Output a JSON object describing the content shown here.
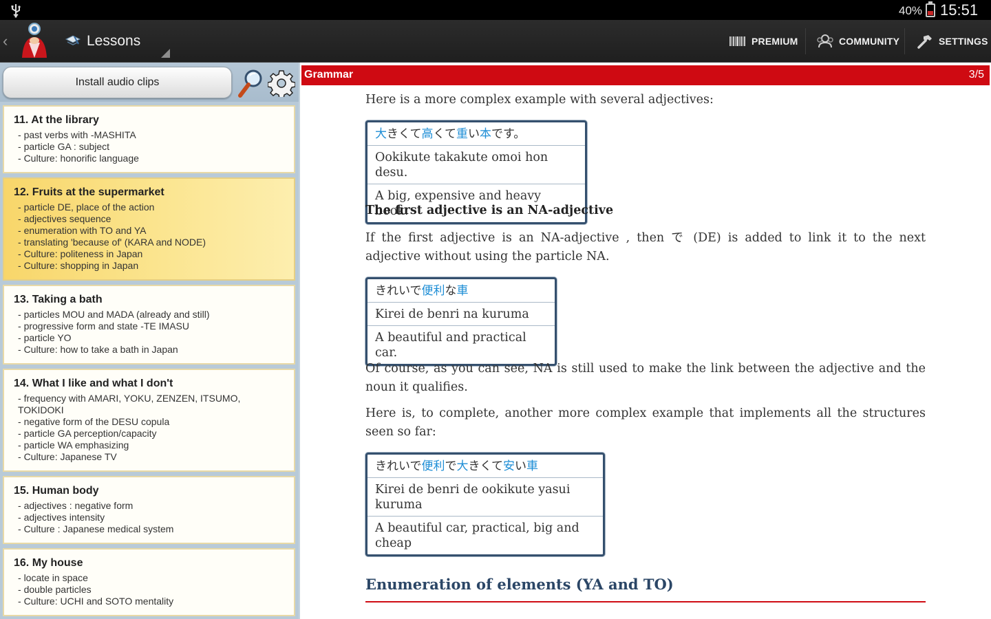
{
  "status_bar": {
    "battery": "40%",
    "time": "15:51"
  },
  "action_bar": {
    "title": "Lessons",
    "premium": "PREMIUM",
    "community": "COMMUNITY",
    "settings": "SETTINGS"
  },
  "sidebar": {
    "install_label": "Install audio clips",
    "lessons": [
      {
        "title": "11. At the library",
        "items": [
          "past verbs with -MASHITA",
          "particle GA : subject",
          "Culture: honorific language"
        ]
      },
      {
        "title": "12. Fruits at the supermarket",
        "items": [
          "particle DE, place of the action",
          "adjectives sequence",
          "enumeration with TO and YA",
          "translating 'because of' (KARA and NODE)",
          "Culture: politeness in Japan",
          "Culture: shopping in Japan"
        ]
      },
      {
        "title": "13. Taking a bath",
        "items": [
          "particles MOU and MADA (already and still)",
          "progressive form and state -TE IMASU",
          "particle YO",
          "Culture: how to take a bath in Japan"
        ]
      },
      {
        "title": "14. What I like and what I don't",
        "items": [
          "frequency with AMARI, YOKU, ZENZEN, ITSUMO, TOKIDOKI",
          "negative form of the DESU copula",
          "particle GA perception/capacity",
          "particle WA emphasizing",
          "Culture: Japanese TV"
        ]
      },
      {
        "title": "15. Human body",
        "items": [
          "adjectives : negative form",
          "adjectives intensity",
          "Culture : Japanese medical system"
        ]
      },
      {
        "title": "16. My house",
        "items": [
          "locate in space",
          "double particles",
          "Culture: UCHI and SOTO mentality"
        ]
      }
    ]
  },
  "content": {
    "header": "Grammar",
    "page": "3/5",
    "intro": "Here is a more complex example with several adjectives:",
    "example1": {
      "jp": [
        [
          "大",
          true
        ],
        [
          "きくて",
          false
        ],
        [
          "高",
          true
        ],
        [
          "くて",
          false
        ],
        [
          "重",
          true
        ],
        [
          "い",
          false
        ],
        [
          "本",
          true
        ],
        [
          "です。",
          false
        ]
      ],
      "romaji": "Ookikute takakute omoi hon desu.",
      "english": "A big, expensive and heavy book."
    },
    "subheading": "The first adjective is an NA-adjective",
    "para1": "If the first adjective is an  NA-adjective , then で (DE) is added to link it to the next adjective without using the particle NA.",
    "example2": {
      "jp": [
        [
          "きれいで",
          false
        ],
        [
          "便利",
          true
        ],
        [
          "な",
          false
        ],
        [
          "車",
          true
        ]
      ],
      "romaji": "Kirei de benri na kuruma",
      "english": "A beautiful and practical car."
    },
    "para2": "Of course, as you can see, NA is still used to make the link between the adjective and the noun it qualifies.",
    "para3": "Here is, to complete, another more complex example that implements all the structures seen so far:",
    "example3": {
      "jp": [
        [
          "きれいで",
          false
        ],
        [
          "便利",
          true
        ],
        [
          "で",
          false
        ],
        [
          "大",
          true
        ],
        [
          "きくて",
          false
        ],
        [
          "安",
          true
        ],
        [
          "い",
          false
        ],
        [
          "車",
          true
        ]
      ],
      "romaji": "Kirei de benri de ookikute yasui kuruma",
      "english": "A beautiful car, practical, big and cheap"
    },
    "section_title": "Enumeration of elements (YA and TO)"
  }
}
